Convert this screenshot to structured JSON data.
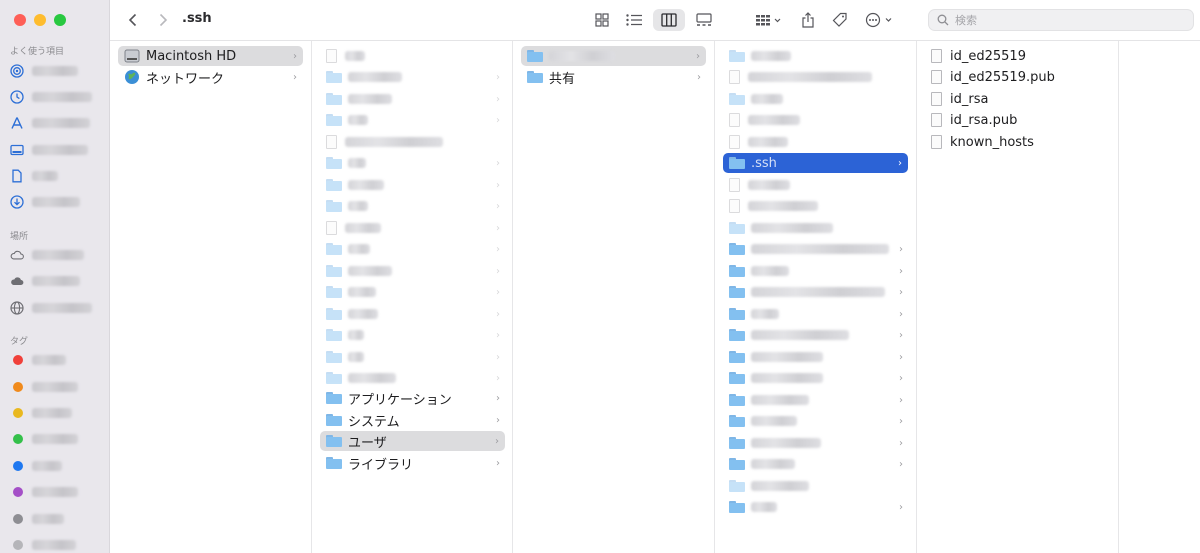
{
  "window": {
    "title": ".ssh"
  },
  "sidebar": {
    "favorites_header": "よく使う項目",
    "locations_header": "場所",
    "tags_header": "タグ",
    "favorites": [
      {
        "icon": "airdrop-icon"
      },
      {
        "icon": "recents-icon"
      },
      {
        "icon": "applications-icon"
      },
      {
        "icon": "desktop-icon"
      },
      {
        "icon": "documents-icon"
      },
      {
        "icon": "downloads-icon"
      }
    ],
    "locations": [
      {
        "icon": "cloud-outline-icon"
      },
      {
        "icon": "cloud-icon"
      },
      {
        "icon": "network-icon"
      }
    ],
    "tags": [
      {
        "color": "#f0403a"
      },
      {
        "color": "#f08a1c"
      },
      {
        "color": "#e9b81f"
      },
      {
        "color": "#34c04a"
      },
      {
        "color": "#1f78f0"
      },
      {
        "color": "#a44fc7"
      },
      {
        "color": "#8e8e93"
      }
    ]
  },
  "toolbar": {
    "search_placeholder": "検索"
  },
  "columns": {
    "col1": [
      {
        "label": "Macintosh HD",
        "icon": "disk-icon",
        "selected": true
      },
      {
        "label": "ネットワーク",
        "icon": "globe-icon",
        "selected": false
      }
    ],
    "col2": [
      {
        "label": "アプリケーション"
      },
      {
        "label": "システム"
      },
      {
        "label": "ユーザ",
        "selected": true
      },
      {
        "label": "ライブラリ"
      }
    ],
    "col3": [
      {
        "label": "共有"
      }
    ],
    "col4": [
      {
        "label": ".ssh",
        "selected": true
      }
    ],
    "col5": [
      {
        "label": "id_ed25519"
      },
      {
        "label": "id_ed25519.pub"
      },
      {
        "label": "id_rsa"
      },
      {
        "label": "id_rsa.pub"
      },
      {
        "label": "known_hosts"
      }
    ]
  }
}
